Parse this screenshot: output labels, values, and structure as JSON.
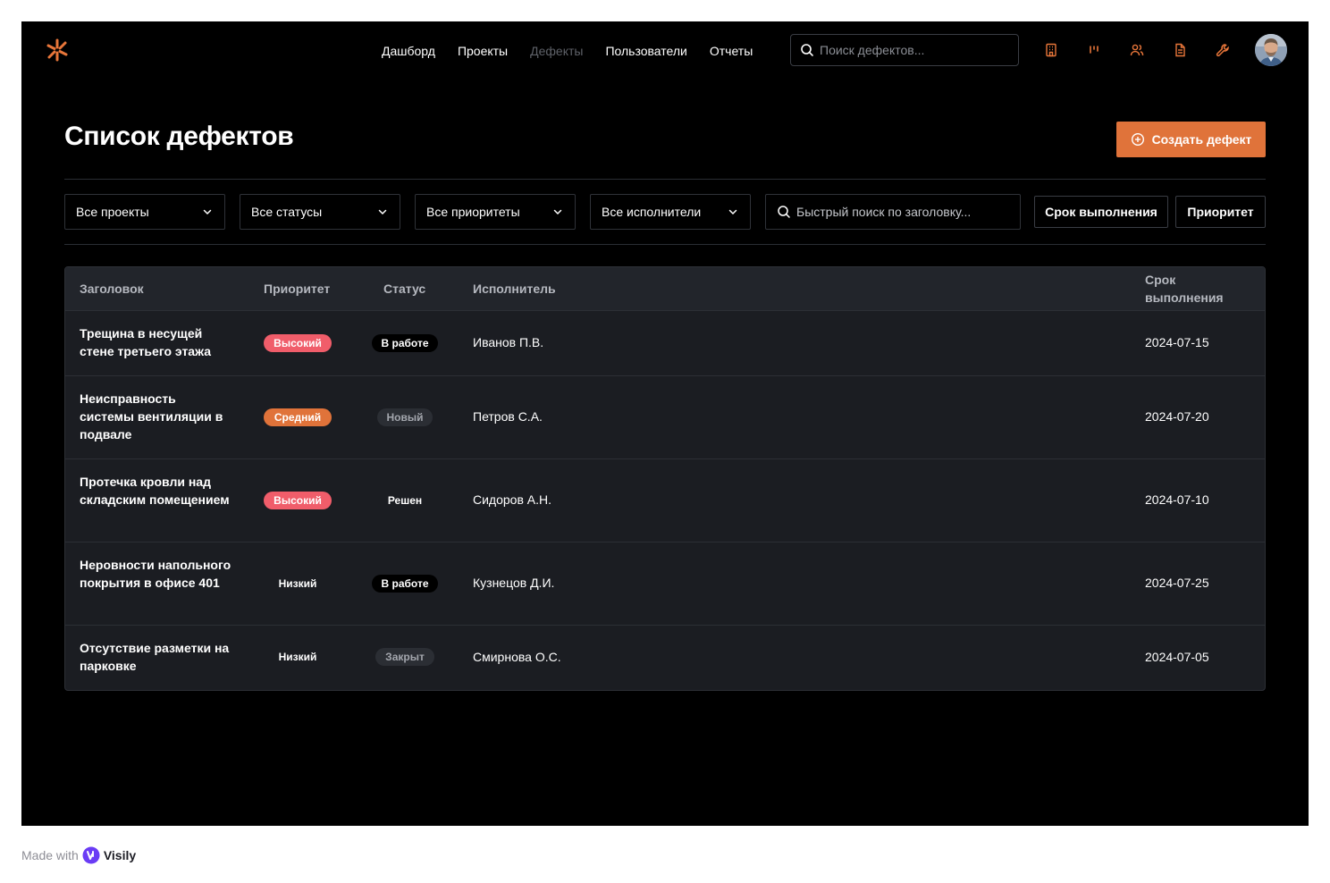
{
  "nav": {
    "items": [
      {
        "label": "Дашборд",
        "active": false
      },
      {
        "label": "Проекты",
        "active": false
      },
      {
        "label": "Дефекты",
        "active": true
      },
      {
        "label": "Пользователи",
        "active": false
      },
      {
        "label": "Отчеты",
        "active": false
      }
    ],
    "search_placeholder": "Поиск дефектов...",
    "icons": [
      "building-icon",
      "kanban-icon",
      "users-icon",
      "document-icon",
      "wrench-icon"
    ],
    "accent": "#e0733a"
  },
  "header": {
    "title": "Список дефектов",
    "create_label": "Создать дефект"
  },
  "filters": {
    "project": "Все проекты",
    "status": "Все статусы",
    "priority": "Все приоритеты",
    "assignee": "Все исполнители",
    "quick_search_placeholder": "Быстрый поиск по заголовку...",
    "sort_due": "Срок выполнения",
    "sort_priority": "Приоритет"
  },
  "table": {
    "columns": {
      "title": "Заголовок",
      "priority": "Приоритет",
      "status": "Статус",
      "assignee": "Исполнитель",
      "due_line1": "Срок",
      "due_line2": "выполнения"
    },
    "rows": [
      {
        "title": "Трещина в несущей стене третьего этажа",
        "priority": "Высокий",
        "status": "В работе",
        "assignee": "Иванов П.В.",
        "due": "2024-07-15"
      },
      {
        "title": "Неисправность системы вентиляции в подвале",
        "priority": "Средний",
        "status": "Новый",
        "assignee": "Петров С.А.",
        "due": "2024-07-20"
      },
      {
        "title": "Протечка кровли над складским помещением",
        "priority": "Высокий",
        "status": "Решен",
        "assignee": "Сидоров А.Н.",
        "due": "2024-07-10"
      },
      {
        "title": "Неровности напольного покрытия в офисе 401",
        "priority": "Низкий",
        "status": "В работе",
        "assignee": "Кузнецов Д.И.",
        "due": "2024-07-25"
      },
      {
        "title": "Отсутствие разметки на парковке",
        "priority": "Низкий",
        "status": "Закрыт",
        "assignee": "Смирнова О.С.",
        "due": "2024-07-05"
      }
    ]
  },
  "footer": {
    "made_with": "Made with",
    "brand": "Visily"
  }
}
